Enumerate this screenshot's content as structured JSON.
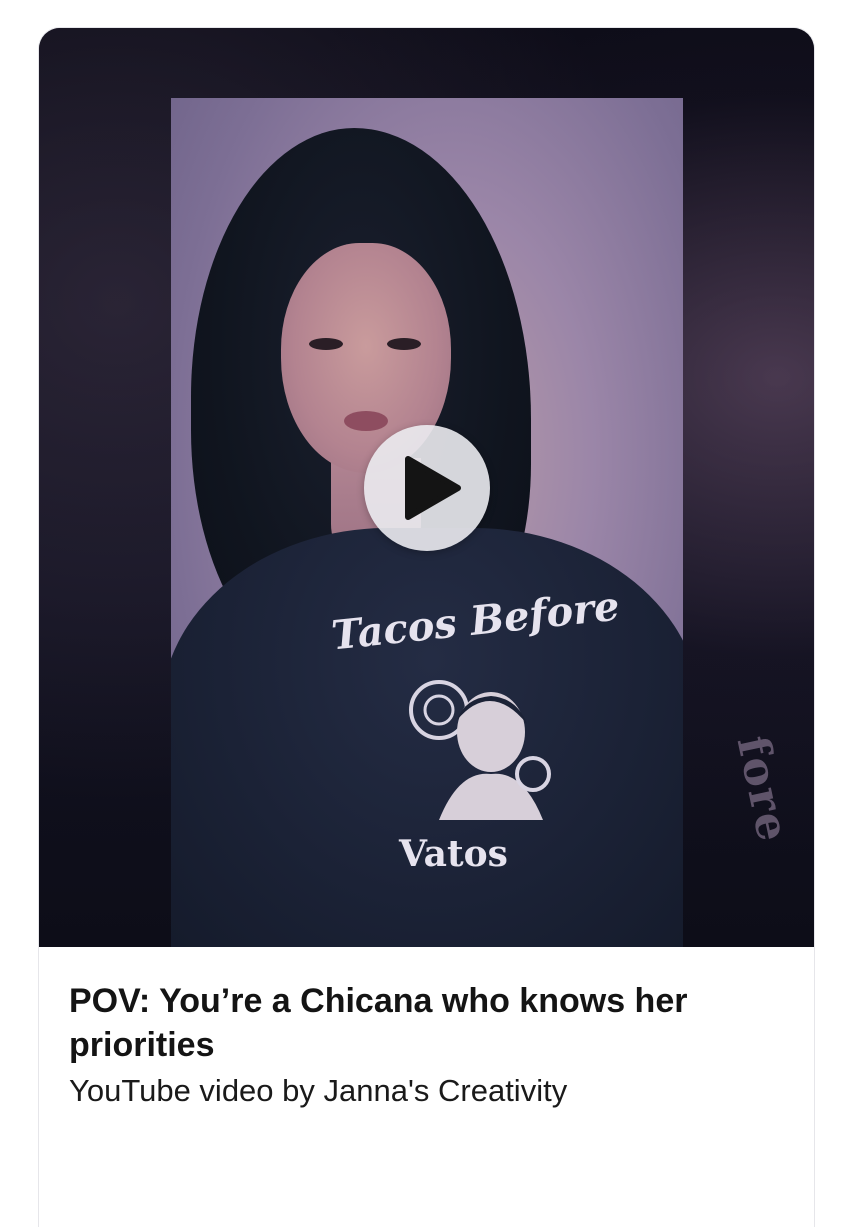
{
  "video": {
    "title": "POV: You’re a Chicana who knows her priorities",
    "subtitle": "YouTube video by Janna's Creativity",
    "thumbnail_text_top": "Tacos Before",
    "thumbnail_text_bottom": "Vatos",
    "thumbnail_side_text": "fore",
    "play_icon": "play-icon"
  },
  "colors": {
    "card_border": "#e6e6ea",
    "thumb_background": "#0b0b14",
    "title_text": "#141414",
    "play_button": "#ebebf0",
    "play_triangle": "#141414"
  }
}
